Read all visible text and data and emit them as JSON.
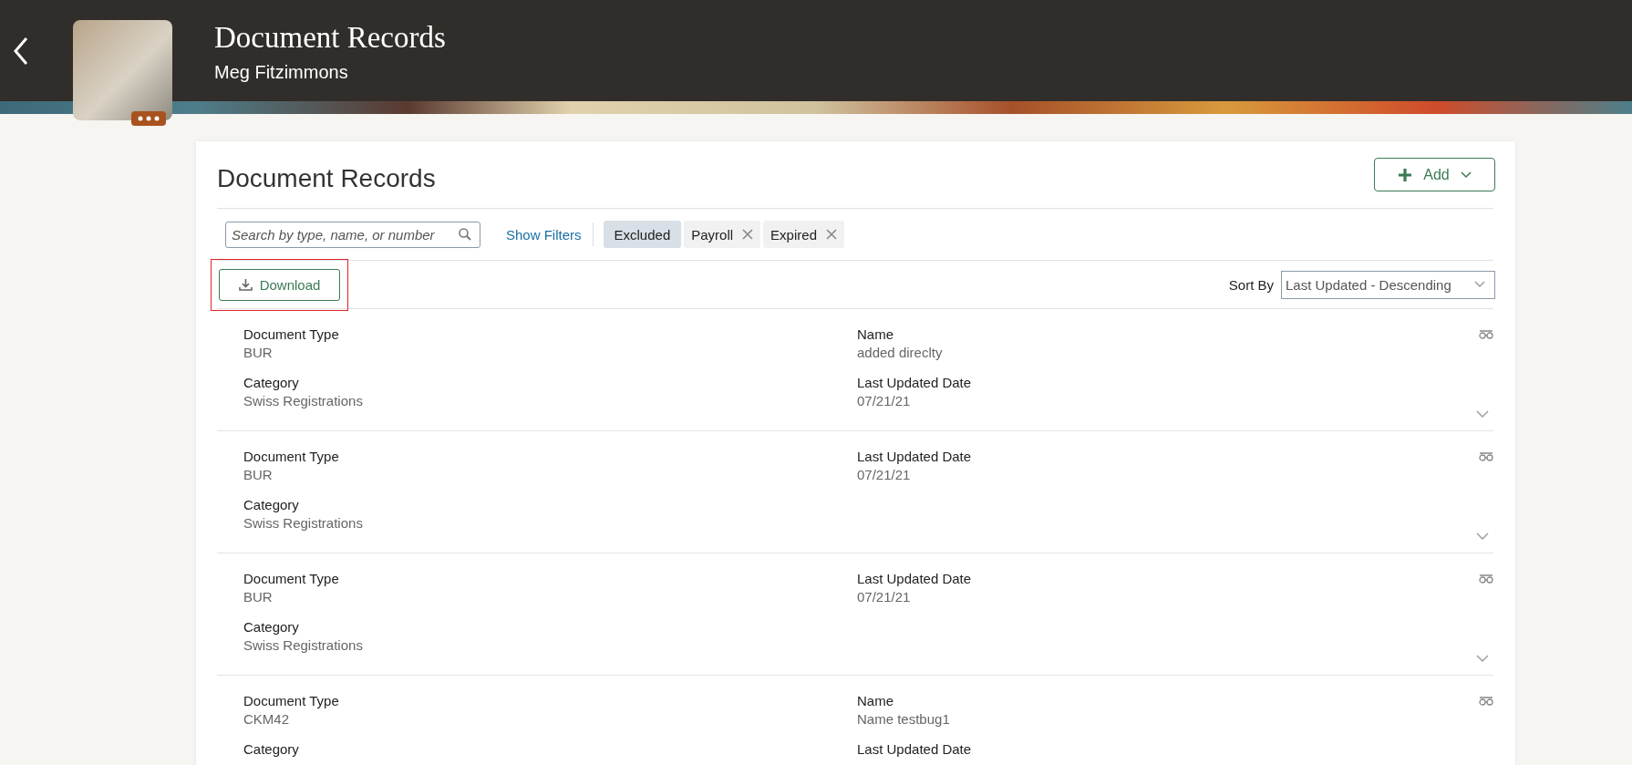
{
  "header": {
    "title": "Document Records",
    "subtitle": "Meg Fitzimmons"
  },
  "card": {
    "title": "Document Records",
    "add_button": "Add",
    "search": {
      "placeholder": "Search by type, name, or number"
    },
    "show_filters": "Show Filters",
    "filter_chips": [
      {
        "label": "Excluded",
        "removable": false
      },
      {
        "label": "Payroll",
        "removable": true
      },
      {
        "label": "Expired",
        "removable": true
      }
    ],
    "download_button": "Download",
    "download_highlighted": true,
    "sort": {
      "label": "Sort By",
      "value": "Last Updated - Descending"
    },
    "records": [
      {
        "fields": [
          {
            "label": "Document Type",
            "value": "BUR"
          },
          {
            "label": "Name",
            "value": "added direclty"
          },
          {
            "label": "Category",
            "value": "Swiss Registrations"
          },
          {
            "label": "Last Updated Date",
            "value": "07/21/21"
          }
        ]
      },
      {
        "fields": [
          {
            "label": "Document Type",
            "value": "BUR"
          },
          {
            "label": "Last Updated Date",
            "value": "07/21/21"
          },
          {
            "label": "Category",
            "value": "Swiss Registrations"
          }
        ]
      },
      {
        "fields": [
          {
            "label": "Document Type",
            "value": "BUR"
          },
          {
            "label": "Last Updated Date",
            "value": "07/21/21"
          },
          {
            "label": "Category",
            "value": "Swiss Registrations"
          }
        ]
      },
      {
        "fields": [
          {
            "label": "Document Type",
            "value": "CKM42"
          },
          {
            "label": "Name",
            "value": "Name testbug1"
          },
          {
            "label": "Category"
          },
          {
            "label": "Last Updated Date"
          }
        ]
      }
    ]
  }
}
